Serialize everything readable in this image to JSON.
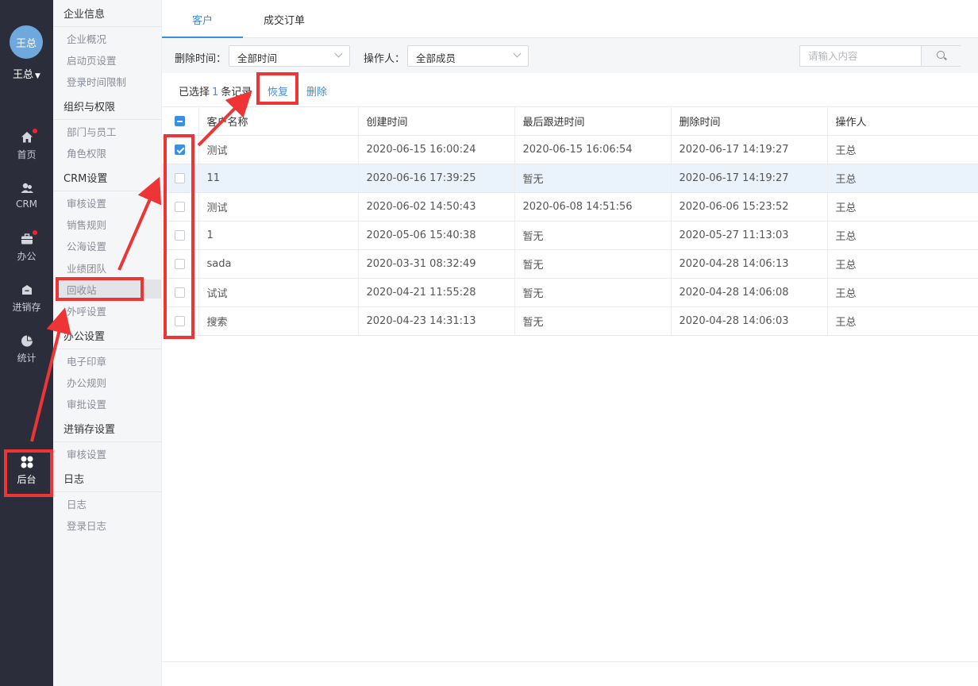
{
  "colors": {
    "rail_bg": "#2b2d3a",
    "accent": "#3a8ee6",
    "annotation_red": "#ee3434",
    "submenu_bg": "#f5f6f8"
  },
  "rail": {
    "avatar_text": "王总",
    "user_name": "王总",
    "items": [
      {
        "label": "首页",
        "icon": "home-icon",
        "badge": true
      },
      {
        "label": "CRM",
        "icon": "crm-people-icon",
        "badge": false
      },
      {
        "label": "办公",
        "icon": "briefcase-icon",
        "badge": true
      },
      {
        "label": "进销存",
        "icon": "warehouse-icon",
        "badge": false
      },
      {
        "label": "统计",
        "icon": "pie-chart-icon",
        "badge": false
      },
      {
        "label": "后台",
        "icon": "grid-cluster-icon",
        "badge": false,
        "active": true
      }
    ]
  },
  "submenu": {
    "groups": [
      {
        "title": "企业信息",
        "items": [
          "企业概况",
          "启动页设置",
          "登录时间限制"
        ]
      },
      {
        "title": "组织与权限",
        "items": [
          "部门与员工",
          "角色权限"
        ]
      },
      {
        "title": "CRM设置",
        "items": [
          "审核设置",
          "销售规则",
          "公海设置",
          "业绩团队",
          "回收站",
          "外呼设置"
        ]
      },
      {
        "title": "办公设置",
        "items": [
          "电子印章",
          "办公规则",
          "审批设置"
        ]
      },
      {
        "title": "进销存设置",
        "items": [
          "审核设置"
        ]
      },
      {
        "title": "日志",
        "items": [
          "日志",
          "登录日志"
        ]
      }
    ],
    "selected": "回收站"
  },
  "tabs": [
    {
      "label": "客户",
      "active": true
    },
    {
      "label": "成交订单",
      "active": false
    }
  ],
  "filters": {
    "delete_time_label": "删除时间：",
    "delete_time_value": "全部时间",
    "operator_label": "操作人：",
    "operator_value": "全部成员",
    "search_placeholder": "请输入内容"
  },
  "actions": {
    "selected_prefix": "已选择",
    "selected_count": "1",
    "selected_suffix": "条记录",
    "restore": "恢复",
    "delete": "删除"
  },
  "table": {
    "headers": [
      "客户名称",
      "创建时间",
      "最后跟进时间",
      "删除时间",
      "操作人"
    ],
    "rows": [
      {
        "checked": true,
        "cells": [
          "测试",
          "2020-06-15 16:00:24",
          "2020-06-15 16:06:54",
          "2020-06-17 14:19:27",
          "王总"
        ]
      },
      {
        "checked": false,
        "cells": [
          "11",
          "2020-06-16 17:39:25",
          "暂无",
          "2020-06-17 14:19:27",
          "王总"
        ]
      },
      {
        "checked": false,
        "cells": [
          "测试",
          "2020-06-02 14:50:43",
          "2020-06-08 14:51:56",
          "2020-06-06 15:23:52",
          "王总"
        ]
      },
      {
        "checked": false,
        "cells": [
          "1",
          "2020-05-06 15:40:38",
          "暂无",
          "2020-05-27 11:13:03",
          "王总"
        ]
      },
      {
        "checked": false,
        "cells": [
          "sada",
          "2020-03-31 08:32:49",
          "暂无",
          "2020-04-28 14:06:13",
          "王总"
        ]
      },
      {
        "checked": false,
        "cells": [
          "试试",
          "2020-04-21 11:55:28",
          "暂无",
          "2020-04-28 14:06:08",
          "王总"
        ]
      },
      {
        "checked": false,
        "cells": [
          "搜索",
          "2020-04-23 14:31:13",
          "暂无",
          "2020-04-28 14:06:03",
          "王总"
        ]
      }
    ]
  }
}
